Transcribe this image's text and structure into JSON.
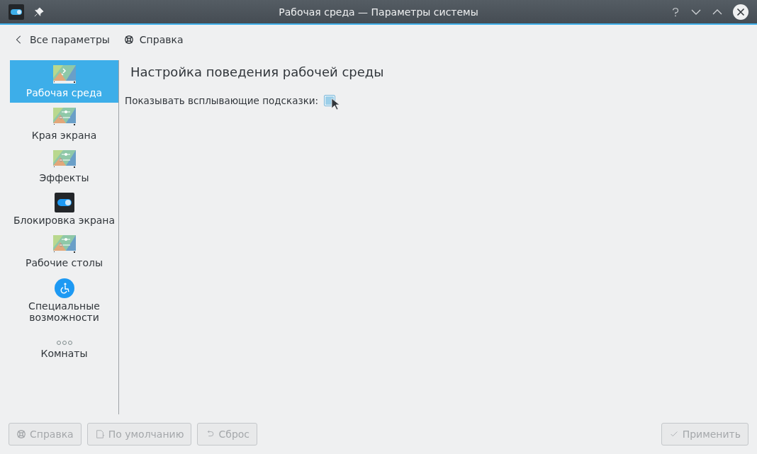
{
  "window": {
    "title": "Рабочая среда  — Параметры системы"
  },
  "toolbar": [
    {
      "kind": "back",
      "label": "Все параметры"
    },
    {
      "kind": "help",
      "label": "Справка"
    }
  ],
  "sidebar": {
    "items": [
      {
        "kind": "wallpaper",
        "label": "Рабочая среда",
        "selected": true
      },
      {
        "kind": "sliders",
        "label": "Края экрана",
        "selected": false
      },
      {
        "kind": "sliders",
        "label": "Эффекты",
        "selected": false
      },
      {
        "kind": "toggle",
        "label": "Блокировка экрана",
        "selected": false
      },
      {
        "kind": "sliders",
        "label": "Рабочие столы",
        "selected": false
      },
      {
        "kind": "accessibility",
        "label": "Специальные возможности",
        "selected": false
      },
      {
        "kind": "dots",
        "label": "Комнаты",
        "selected": false
      }
    ]
  },
  "content": {
    "heading": "Настройка поведения рабочей среды",
    "option": {
      "label": "Показывать всплывающие подсказки:",
      "checked": true
    }
  },
  "buttons": [
    {
      "kind": "help",
      "label": "Справка",
      "disabled": true
    },
    {
      "kind": "defaults",
      "label": "По умолчанию",
      "disabled": true
    },
    {
      "kind": "reset",
      "label": "Сброс",
      "disabled": true
    },
    {
      "kind": "apply",
      "label": "Применить",
      "disabled": true
    }
  ]
}
